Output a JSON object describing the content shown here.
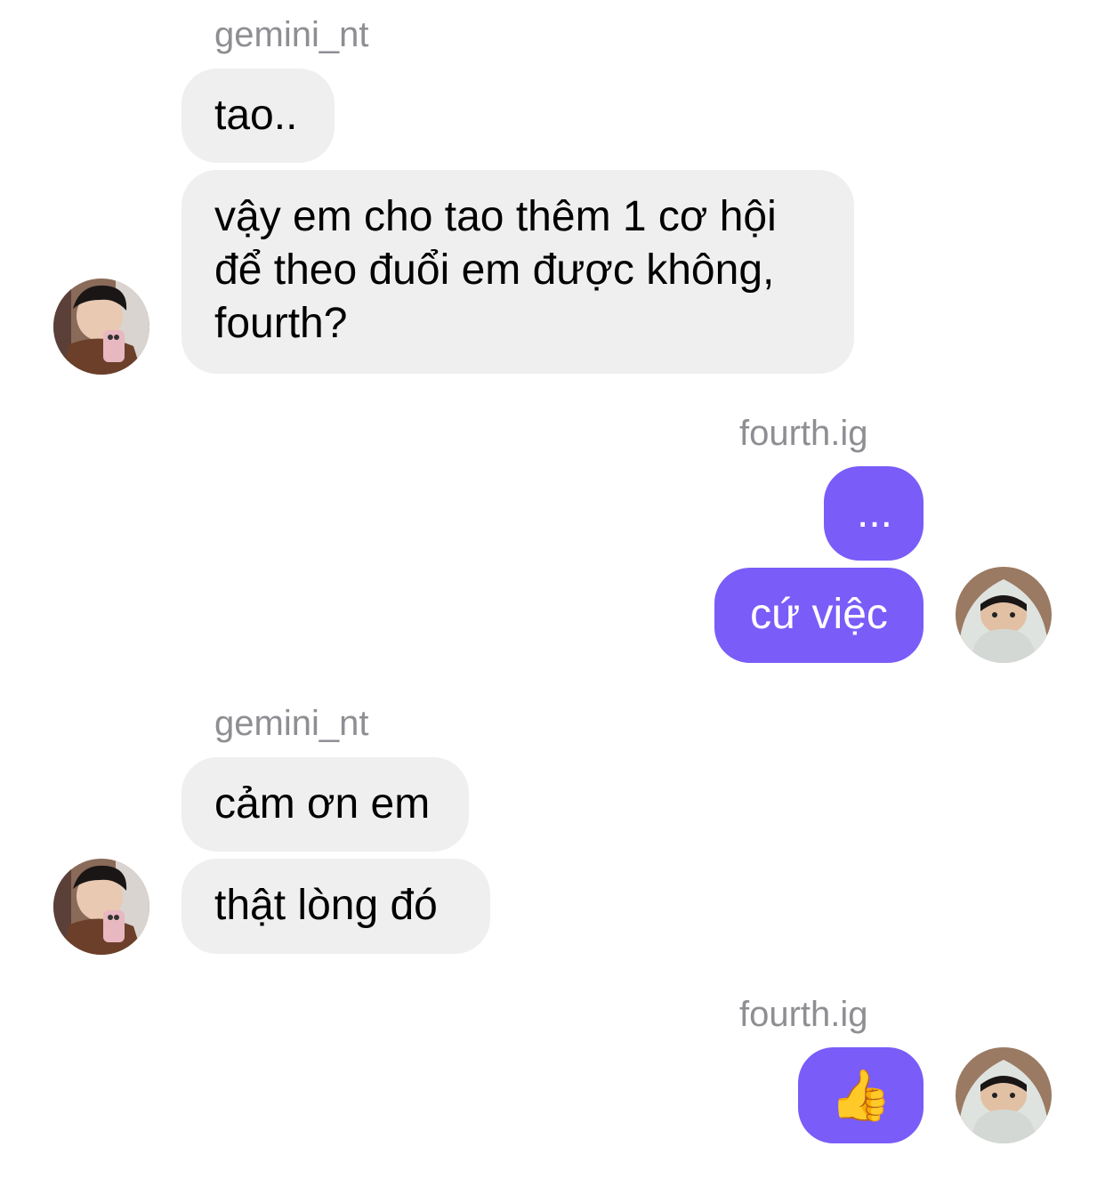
{
  "colors": {
    "background": "#ffffff",
    "incoming_bubble": "#efefef",
    "outgoing_bubble": "#7a5cf8",
    "sender_name": "#8e8e93"
  },
  "groups": [
    {
      "sender": "gemini_nt",
      "direction": "incoming",
      "messages": [
        "tao..",
        "vậy em cho tao thêm 1 cơ hội|để theo đuổi em được không,|fourth?"
      ]
    },
    {
      "sender": "fourth.ig",
      "direction": "outgoing",
      "messages": [
        "...",
        "cứ việc"
      ]
    },
    {
      "sender": "gemini_nt",
      "direction": "incoming",
      "messages": [
        "cảm ơn em",
        "thật lòng đó"
      ]
    },
    {
      "sender": "fourth.ig",
      "direction": "outgoing",
      "messages": [
        "👍"
      ]
    }
  ],
  "multiline": {
    "line1": "vậy em cho tao thêm 1 cơ hội",
    "line2": "để theo đuổi em được không,",
    "line3": "fourth?"
  },
  "icons": {
    "gemini_avatar": "avatar-gemini-icon",
    "fourth_avatar": "avatar-fourth-icon"
  }
}
